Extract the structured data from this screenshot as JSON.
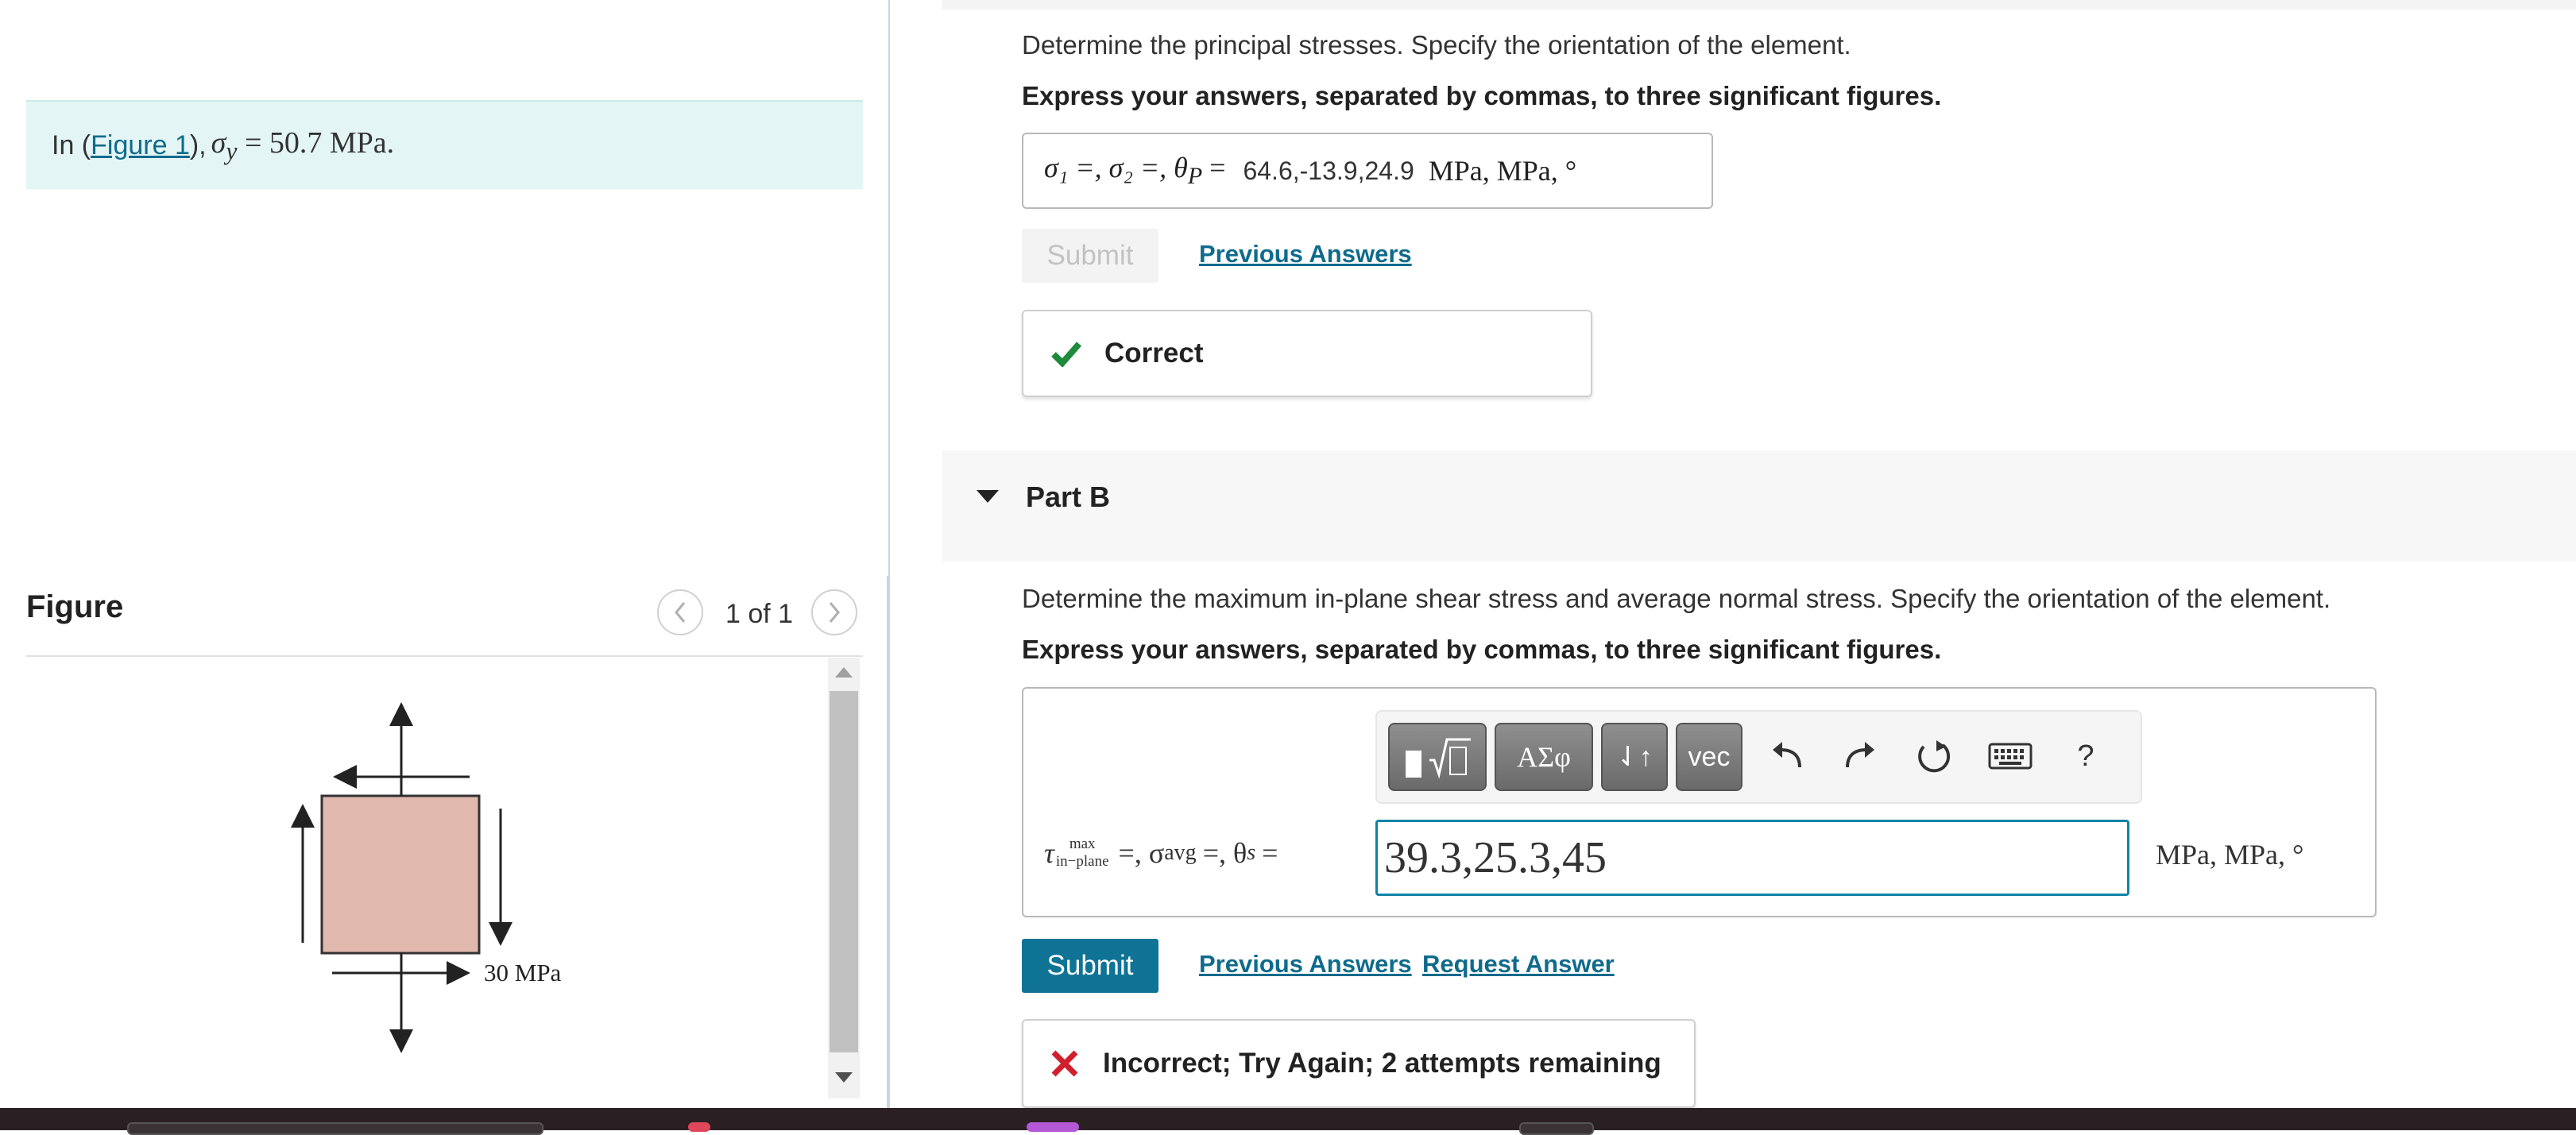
{
  "left": {
    "given": {
      "prefix": "In (",
      "link": "Figure 1",
      "suffix": "), ",
      "sigma_symbol": "σ",
      "sigma_sub": "y",
      "equals_value": "= 50.7 MPa."
    },
    "figure": {
      "title": "Figure",
      "counter": "1 of 1",
      "load_label": "30 MPa",
      "element_color": "#e0b8ae"
    }
  },
  "part_a": {
    "question": "Determine the principal stresses. Specify the orientation of the element.",
    "instruction": "Express your answers, separated by commas, to three significant figures.",
    "answer_label": "σ₁ =, σ₂ =, θ",
    "answer_label_sub": "P",
    "answer_label_eq": "=",
    "answer_value": "64.6,-13.9,24.9",
    "answer_units": "MPa,  MPa,  °",
    "submit_label": "Submit",
    "previous_answers": "Previous Answers",
    "feedback": "Correct",
    "feedback_color": "#1e8a3c"
  },
  "part_b": {
    "title": "Part B",
    "question": "Determine the maximum in-plane shear stress and average normal stress. Specify the orientation of the element.",
    "instruction": "Express your answers, separated by commas, to three significant figures.",
    "toolbar": {
      "templates_icon": "templates-icon",
      "greek": "ΑΣφ",
      "arrows": "⇃↑",
      "vec": "vec",
      "help": "?"
    },
    "label_tau": "τ",
    "label_tau_sup": "max",
    "label_tau_sub": "in−plane",
    "label_rest": "=, σ",
    "label_avg_sub": "avg",
    "label_rest2": "=, θ",
    "label_s_sub": "s",
    "label_eq": "=",
    "input_value": "39.3,25.3,45",
    "units": "MPa,  MPa,  °",
    "submit_label": "Submit",
    "previous_answers": "Previous Answers",
    "request_answer": "Request Answer",
    "feedback": "Incorrect; Try Again; 2 attempts remaining",
    "feedback_color": "#d0202e"
  },
  "colors": {
    "accent": "#0f7396",
    "link": "#0f6b8c",
    "given_bg": "#e3f5f5"
  }
}
